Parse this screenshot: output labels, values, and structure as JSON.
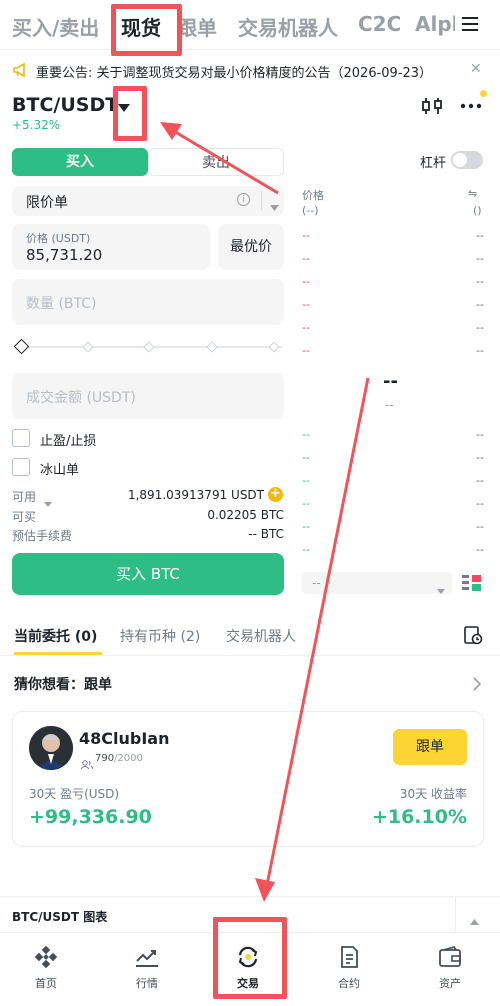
{
  "topnav": {
    "tabs": [
      "买入/卖出",
      "现货",
      "跟单",
      "交易机器人",
      "C2C",
      "Alpl"
    ]
  },
  "notice": {
    "text": "重要公告: 关于调整现货交易对最小价格精度的公告（2026-09-23）"
  },
  "pair": {
    "symbol": "BTC/USDT",
    "change": "+5.32%"
  },
  "trade": {
    "buy_tab": "买入",
    "sell_tab": "卖出",
    "margin_label": "杠杆",
    "order_type": "限价单",
    "price_label": "价格 (USDT)",
    "price_value": "85,731.20",
    "best_price": "最优价",
    "qty_placeholder": "数量 (BTC)",
    "amount_placeholder": "成交金额 (USDT)",
    "tp_sl": "止盈/止损",
    "iceberg": "冰山单",
    "avail_label": "可用",
    "avail_value": "1,891.03913791 USDT",
    "canbuy_label": "可买",
    "canbuy_value": "0.02205 BTC",
    "fee_label": "预估手续费",
    "fee_value": "-- BTC",
    "buy_button": "买入 BTC"
  },
  "orderbook": {
    "price_header": "价格",
    "price_unit": "(--)",
    "qty_header": "⇋",
    "qty_unit": "()",
    "dash": "--",
    "mid_price": "--",
    "mid_sub": "--",
    "precision": "--"
  },
  "orders": {
    "tabs": [
      "当前委托 (0)",
      "持有币种 (2)",
      "交易机器人"
    ]
  },
  "guess": {
    "title": "猜你想看：跟单"
  },
  "copy": {
    "name": "48ClubIan",
    "followers": "790",
    "followers_max": "/2000",
    "follow_button": "跟单",
    "pnl_label": "30天 盈亏(USD)",
    "pnl_value": "+99,336.90",
    "roi_label": "30天 收益率",
    "roi_value": "+16.10%"
  },
  "chart_bar": {
    "label": "BTC/USDT 图表"
  },
  "bottomnav": {
    "items": [
      "首页",
      "行情",
      "交易",
      "合约",
      "资产"
    ]
  },
  "colors": {
    "accent_green": "#2ebd85",
    "red": "#f6465d",
    "annotation_red": "#f0545a",
    "yellow": "#fcd535"
  }
}
